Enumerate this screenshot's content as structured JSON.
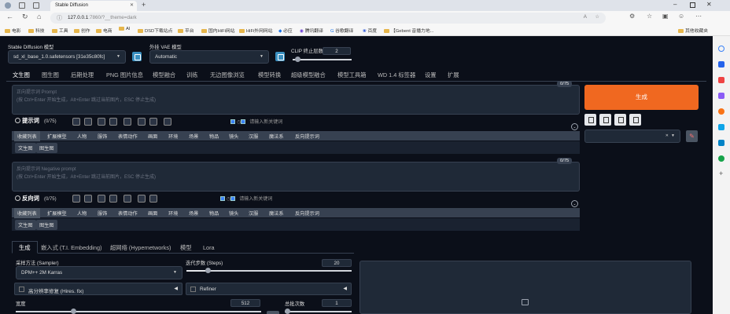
{
  "browser": {
    "tab_title": "Stable Diffusion",
    "url_host": "127.0.0.1",
    "url_rest": ":7860/?__theme=dark",
    "bookmarks": [
      "电影",
      "科技",
      "工具",
      "创作",
      "电商",
      "AI",
      "DSD下载站点",
      "平台",
      "国内HiFi网站",
      "HiFi外网网站",
      "必应",
      "腾讯翻译",
      "谷歌翻译",
      "百度",
      "【Gebent 音播力地..."
    ],
    "other_bookmarks": "其他收藏夹"
  },
  "model": {
    "checkpoint_label": "Stable Diffusion 模型",
    "checkpoint_value": "sd_xl_base_1.0.safetensors [31e35c80fc]",
    "vae_label": "外挂 VAE 模型",
    "vae_value": "Automatic",
    "clip_label": "CLIP 终止层数",
    "clip_value": "2"
  },
  "main_tabs": [
    "文生图",
    "图生图",
    "后期处理",
    "PNG 图片信息",
    "模型融合",
    "训练",
    "无边图像浏览",
    "模型转换",
    "超级模型融合",
    "模型工具箱",
    "WD 1.4 标签器",
    "设置",
    "扩展"
  ],
  "prompt": {
    "placeholder_line1": "正向提示词 Prompt",
    "placeholder_line2": "(按 Ctrl+Enter 开始生成，Alt+Enter 跳过当前图片，ESC 停止生成)",
    "counter": "0/75",
    "helper_title": "提示词",
    "helper_count": "(0/75)",
    "keyword_placeholder": "请输入新关键词"
  },
  "negative": {
    "placeholder_line1": "反向提示词 Negative prompt",
    "placeholder_line2": "(按 Ctrl+Enter 开始生成，Alt+Enter 跳过当前图片，ESC 停止生成)",
    "counter": "0/75",
    "helper_title": "反向词",
    "helper_count": "(0/75)",
    "keyword_placeholder": "请输入新关键词"
  },
  "categories": [
    "收藏列表",
    "扩展模型",
    "人物",
    "服饰",
    "表情动作",
    "画面",
    "环境",
    "场景",
    "物品",
    "镜头",
    "汉服",
    "魔法系",
    "反向提示词"
  ],
  "subcategories": [
    "文生图",
    "图生图"
  ],
  "generate_label": "生成",
  "lower_tabs": [
    "生成",
    "嵌入式 (T.I. Embedding)",
    "超网络 (Hypernetworks)",
    "模型",
    "Lora"
  ],
  "sampler": {
    "label": "采样方法 (Sampler)",
    "value": "DPM++ 2M Karras",
    "steps_label": "迭代步数 (Steps)",
    "steps_value": "20",
    "steps_fraction": 0.13
  },
  "hires_label": "高分辨率修复 (Hires. fix)",
  "refiner_label": "Refiner",
  "width_label": "宽度",
  "width_value": "512",
  "batch_count_label": "总批次数",
  "batch_count_value": "1"
}
